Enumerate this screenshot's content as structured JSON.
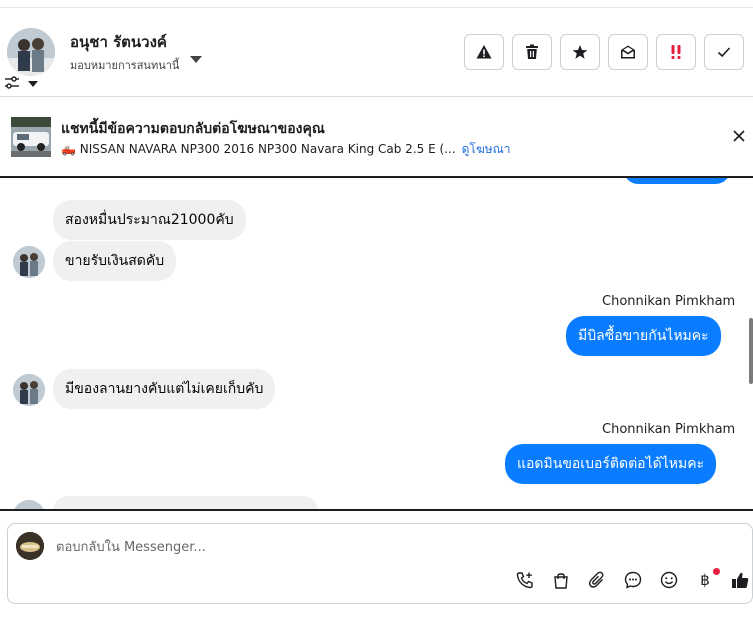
{
  "header": {
    "contact_name": "อนุชา รัตนวงค์",
    "assign_label": "มอบหมายการสนทนานี้",
    "actions": [
      {
        "name": "report-button",
        "icon": "warning-icon"
      },
      {
        "name": "delete-button",
        "icon": "trash-icon"
      },
      {
        "name": "star-button",
        "icon": "star-icon"
      },
      {
        "name": "mark-unread-button",
        "icon": "envelope-open-icon"
      },
      {
        "name": "follow-up-button",
        "icon": "double-exclamation-icon"
      },
      {
        "name": "mark-done-button",
        "icon": "checkmark-icon"
      }
    ]
  },
  "ad": {
    "title": "แชทนี้มีข้อความตอบกลับต่อโฆษณาของคุณ",
    "subtitle": "🛻 NISSAN NAVARA NP300 2016 NP300 Navara King Cab 2.5 E (...",
    "link": "ดูโฆษณา"
  },
  "messages": [
    {
      "side": "in",
      "text": "สองหมื่นประมาณ21000คับ"
    },
    {
      "side": "in",
      "text": "ขายรับเงินสดคับ"
    },
    {
      "side": "out",
      "sender": "Chonnikan Pimkham",
      "text": "มีบิลซื้อขายกันไหมคะ"
    },
    {
      "side": "in",
      "text": "มีของลานยางคับแต่ไม่เคยเก็บคับ"
    },
    {
      "side": "out",
      "sender": "Chonnikan Pimkham",
      "text": "แอดมินขอเบอร์ติดต่อได้ไหมคะ"
    }
  ],
  "composer": {
    "placeholder": "ตอบกลับใน Messenger...",
    "baht_symbol": "฿",
    "tools": [
      "phone-add-icon",
      "shopping-bag-icon",
      "paperclip-icon",
      "chat-bubble-icon",
      "emoji-icon",
      "baht-icon",
      "thumbs-up-icon"
    ]
  },
  "colors": {
    "outgoing_bubble": "#0a7cff",
    "incoming_bubble": "#f0f0f0",
    "link": "#216fdb",
    "follow_up": "#e41e3f"
  }
}
